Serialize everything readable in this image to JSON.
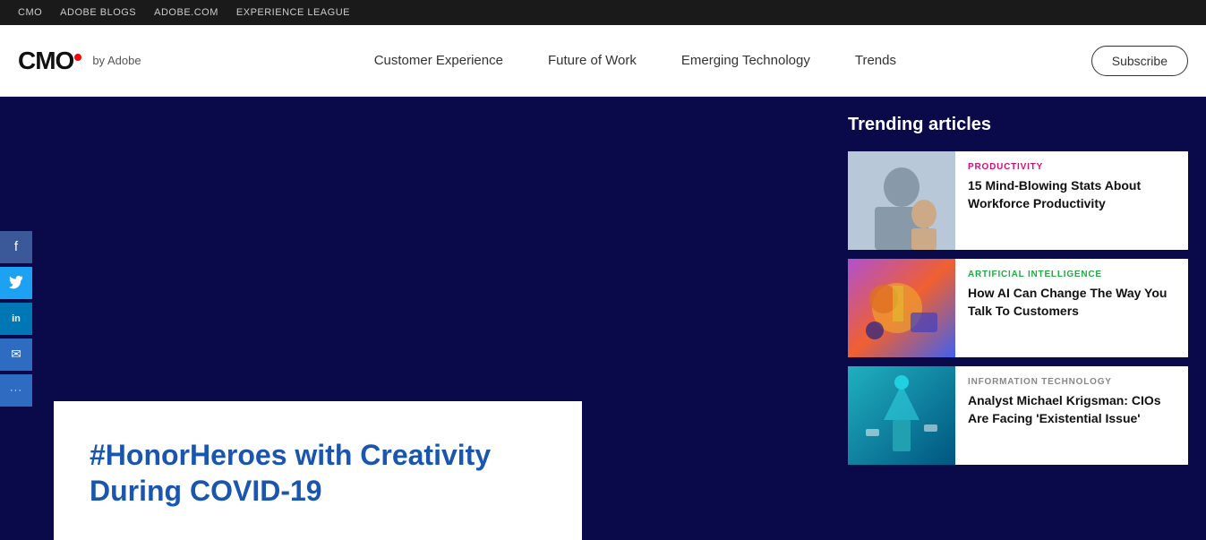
{
  "topbar": {
    "links": [
      "CMO",
      "ADOBE BLOGS",
      "ADOBE.COM",
      "EXPERIENCE LEAGUE"
    ]
  },
  "header": {
    "logo_cmo": "CMO",
    "logo_by": "by Adobe",
    "nav": [
      {
        "label": "Customer Experience",
        "key": "customer-experience"
      },
      {
        "label": "Future of Work",
        "key": "future-of-work"
      },
      {
        "label": "Emerging Technology",
        "key": "emerging-technology"
      },
      {
        "label": "Trends",
        "key": "trends"
      }
    ],
    "subscribe_label": "Subscribe"
  },
  "hero": {
    "article_title": "#HonorHeroes with Creativity During COVID-19"
  },
  "social": {
    "buttons": [
      {
        "icon": "f",
        "name": "facebook",
        "label": "Facebook"
      },
      {
        "icon": "🐦",
        "name": "twitter",
        "label": "Twitter"
      },
      {
        "icon": "in",
        "name": "linkedin",
        "label": "LinkedIn"
      },
      {
        "icon": "✉",
        "name": "email",
        "label": "Email"
      },
      {
        "icon": "···",
        "name": "more",
        "label": "More"
      }
    ]
  },
  "trending": {
    "title": "Trending articles",
    "articles": [
      {
        "category": "PRODUCTIVITY",
        "category_key": "productivity",
        "heading": "15 Mind-Blowing Stats About Workforce Productivity",
        "thumb_class": "thumb1"
      },
      {
        "category": "ARTIFICIAL INTELLIGENCE",
        "category_key": "ai",
        "heading": "How AI Can Change The Way You Talk To Customers",
        "thumb_class": "thumb2"
      },
      {
        "category": "INFORMATION TECHNOLOGY",
        "category_key": "it",
        "heading": "Analyst Michael Krigsman: CIOs Are Facing 'Existential Issue'",
        "thumb_class": "thumb3"
      }
    ]
  }
}
